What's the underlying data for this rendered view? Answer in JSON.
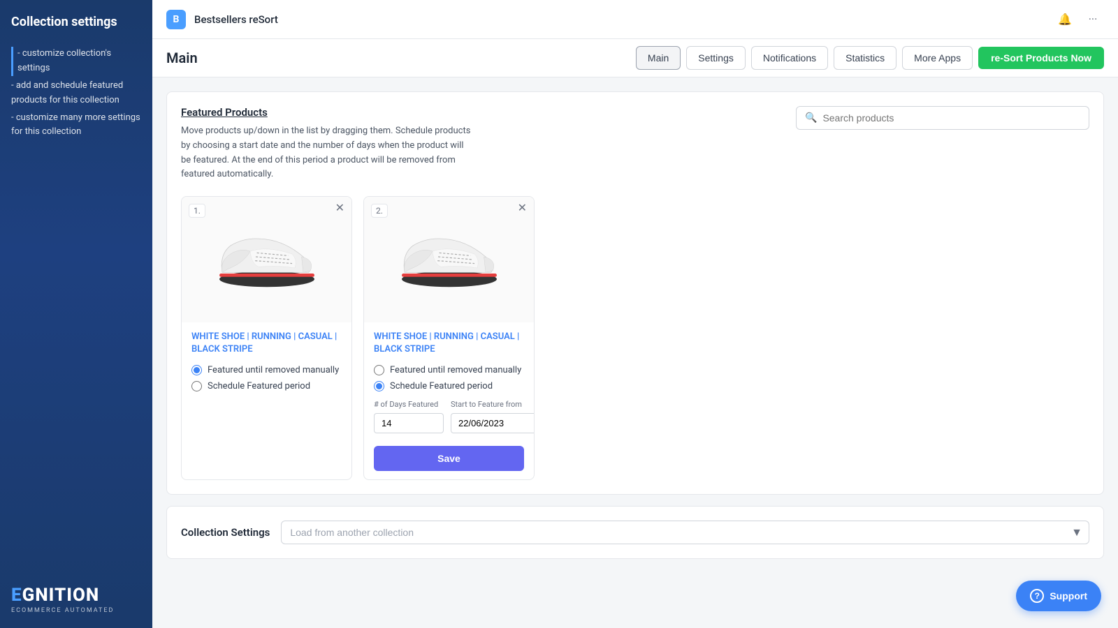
{
  "sidebar": {
    "title": "Collection settings",
    "nav_items": [
      {
        "label": "- customize collection's settings",
        "active": true
      },
      {
        "label": "- add and schedule featured products for this collection",
        "active": false
      },
      {
        "label": "- customize many more settings for this collection",
        "active": false
      }
    ],
    "brand_name_e": "E",
    "brand_name_rest": "GNITION",
    "brand_subtitle": "ECOMMERCE AUTOMATED"
  },
  "topbar": {
    "app_icon_letter": "B",
    "app_name": "Bestsellers reSort",
    "notification_icon": "🔔",
    "more_icon": "···"
  },
  "nav": {
    "page_title": "Main",
    "buttons": [
      {
        "label": "Main",
        "active": true
      },
      {
        "label": "Settings",
        "active": false
      },
      {
        "label": "Notifications",
        "active": false
      },
      {
        "label": "Statistics",
        "active": false
      },
      {
        "label": "More Apps",
        "active": false
      }
    ],
    "primary_btn": "re-Sort Products Now"
  },
  "featured_products": {
    "title": "Featured Products",
    "description": "Move products up/down in the list by dragging them. Schedule products by choosing a start date and the number of days when the product will be featured. At the end of this period a product will be removed from featured automatically.",
    "search_placeholder": "Search products",
    "products": [
      {
        "number": "1.",
        "name": "WHITE SHOE | RUNNING | CASUAL | BLACK STRIPE",
        "radio_options": [
          {
            "label": "Featured until removed manually",
            "selected": true
          },
          {
            "label": "Schedule Featured period",
            "selected": false
          }
        ],
        "show_schedule": false
      },
      {
        "number": "2.",
        "name": "WHITE SHOE | RUNNING | CASUAL | BLACK STRIPE",
        "radio_options": [
          {
            "label": "Featured until removed manually",
            "selected": false
          },
          {
            "label": "Schedule Featured period",
            "selected": true
          }
        ],
        "show_schedule": true,
        "days_label": "# of Days Featured",
        "date_label": "Start to Feature from",
        "days_value": "14",
        "date_value": "22/06/2023",
        "save_label": "Save"
      }
    ]
  },
  "collection_settings": {
    "label": "Collection Settings",
    "select_placeholder": "Load from another collection"
  },
  "support": {
    "label": "Support"
  }
}
